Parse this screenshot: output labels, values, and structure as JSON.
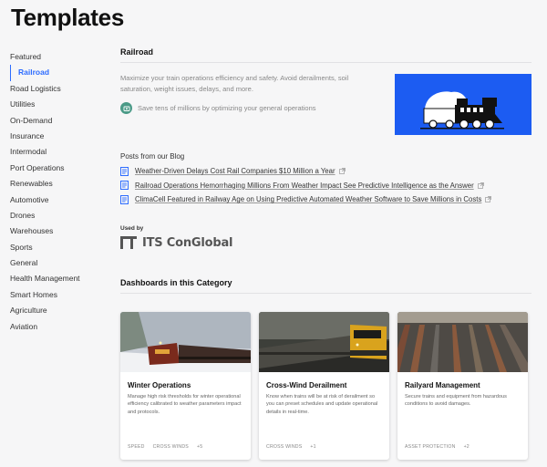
{
  "page": {
    "title": "Templates"
  },
  "sidebar": {
    "items": [
      {
        "label": "Featured"
      },
      {
        "label": "Railroad"
      },
      {
        "label": "Road Logistics"
      },
      {
        "label": "Utilities"
      },
      {
        "label": "On-Demand"
      },
      {
        "label": "Insurance"
      },
      {
        "label": "Intermodal"
      },
      {
        "label": "Port Operations"
      },
      {
        "label": "Renewables"
      },
      {
        "label": "Automotive"
      },
      {
        "label": "Drones"
      },
      {
        "label": "Warehouses"
      },
      {
        "label": "Sports"
      },
      {
        "label": "General"
      },
      {
        "label": "Health Management"
      },
      {
        "label": "Smart Homes"
      },
      {
        "label": "Agriculture"
      },
      {
        "label": "Aviation"
      }
    ],
    "active": "Railroad"
  },
  "category": {
    "title": "Railroad",
    "description": "Maximize your train operations efficiency and safety. Avoid derailments, soil saturation, weight issues, delays, and more.",
    "savings": "Save tens of millions by optimizing your general operations",
    "hero_color": "#1c5cf2"
  },
  "blog": {
    "heading": "Posts from our Blog",
    "posts": [
      {
        "title": "Weather-Driven Delays Cost Rail Companies $10 Million a Year"
      },
      {
        "title": "Railroad Operations Hemorrhaging Millions From Weather Impact See Predictive Intelligence as the Answer"
      },
      {
        "title": "ClimaCell Featured in Railway Age on Using Predictive Automated Weather Software to Save Millions in Costs"
      }
    ]
  },
  "used_by": {
    "label": "Used by",
    "company": "ITS ConGlobal"
  },
  "dashboards": {
    "heading": "Dashboards in this Category",
    "cards": [
      {
        "title": "Winter Operations",
        "description": "Manage high risk thresholds for winter operational efficiency calibrated to weather parameters impact and protocols.",
        "tags": [
          "SPEED",
          "CROSS WINDS",
          "+5"
        ]
      },
      {
        "title": "Cross-Wind Derailment",
        "description": "Know when trains will be at risk of derailment so you can preset schedules and update operational details in real-time.",
        "tags": [
          "CROSS WINDS",
          "+1"
        ]
      },
      {
        "title": "Railyard Management",
        "description": "Secure trains and equipment from hazardous conditions to avoid damages.",
        "tags": [
          "ASSET PROTECTION",
          "+2"
        ]
      }
    ]
  },
  "colors": {
    "accent": "#2d6cff",
    "savings_icon": "#4a9a87"
  }
}
